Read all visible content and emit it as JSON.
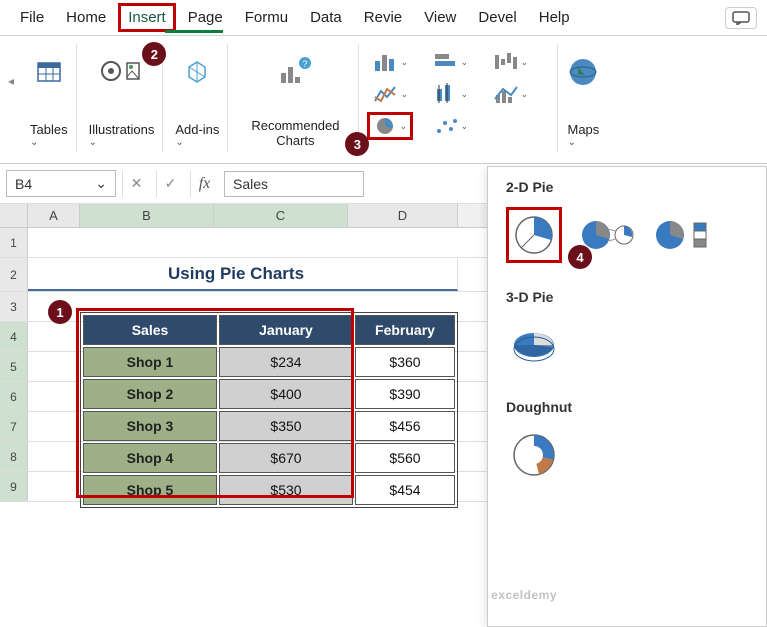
{
  "tabs": {
    "items": [
      "File",
      "Home",
      "Insert",
      "Page",
      "Formu",
      "Data",
      "Revie",
      "View",
      "Devel",
      "Help"
    ],
    "active": "Insert"
  },
  "ribbon": {
    "tables": "Tables",
    "illustrations": "Illustrations",
    "addins": "Add-ins",
    "recommended": "Recommended Charts",
    "maps": "Maps"
  },
  "namebox": {
    "ref": "B4",
    "formula": "Sales"
  },
  "columns": [
    "A",
    "B",
    "C",
    "D"
  ],
  "rows": [
    "1",
    "2",
    "3",
    "4",
    "5",
    "6",
    "7",
    "8",
    "9"
  ],
  "sheet_title": "Using Pie Charts",
  "table": {
    "headers": [
      "Sales",
      "January",
      "February"
    ],
    "rows": [
      {
        "shop": "Shop 1",
        "jan": "$234",
        "feb": "$360"
      },
      {
        "shop": "Shop 2",
        "jan": "$400",
        "feb": "$390"
      },
      {
        "shop": "Shop 3",
        "jan": "$350",
        "feb": "$456"
      },
      {
        "shop": "Shop 4",
        "jan": "$670",
        "feb": "$560"
      },
      {
        "shop": "Shop 5",
        "jan": "$530",
        "feb": "$454"
      }
    ]
  },
  "dropdown": {
    "section1": "2-D Pie",
    "section2": "3-D Pie",
    "section3": "Doughnut"
  },
  "badges": {
    "b1": "1",
    "b2": "2",
    "b3": "3",
    "b4": "4"
  },
  "watermark": "exceldemy",
  "chart_data": {
    "type": "table",
    "title": "Using Pie Charts",
    "columns": [
      "Sales",
      "January",
      "February"
    ],
    "rows": [
      [
        "Shop 1",
        234,
        360
      ],
      [
        "Shop 2",
        400,
        390
      ],
      [
        "Shop 3",
        350,
        456
      ],
      [
        "Shop 4",
        670,
        560
      ],
      [
        "Shop 5",
        530,
        454
      ]
    ]
  }
}
